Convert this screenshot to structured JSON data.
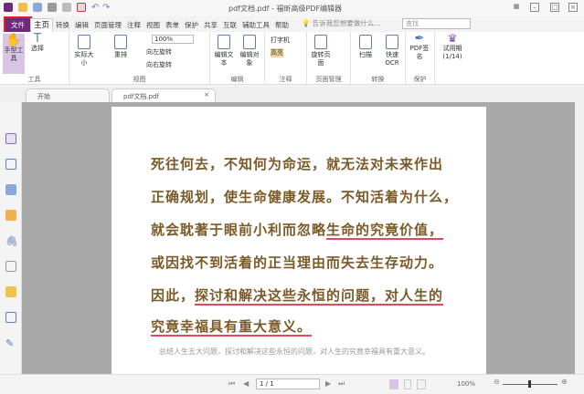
{
  "window": {
    "title": "pdf文档.pdf - 福昕高级PDF编辑器"
  },
  "menu_tabs": [
    "文件",
    "主页",
    "转换",
    "编辑",
    "页面管理",
    "注释",
    "视图",
    "表单",
    "保护",
    "共享",
    "互联",
    "辅助工具",
    "帮助"
  ],
  "search": {
    "placeholder": "告诉我您想要做什么...",
    "find_placeholder": "查找"
  },
  "ribbon": {
    "hand_tool": "手型工具",
    "select": "选择",
    "group_tools": "工具",
    "actual_size": "实际大小",
    "reflow": "重排",
    "zoom": "100%",
    "rotate_left": "向左旋转",
    "rotate_right": "向右旋转",
    "group_view": "视图",
    "edit_text": "编辑文本",
    "edit_object": "编辑对象",
    "group_edit": "编辑",
    "typewriter": "打字机",
    "highlight": "高亮",
    "group_comment": "注释",
    "rotate_page": "旋转页面",
    "group_page": "页面管理",
    "scan": "扫描",
    "quick_ocr": "快速OCR",
    "group_convert": "转换",
    "pdf_sign": "PDF签名",
    "group_protect": "保护",
    "trial": "试用期(1/14)"
  },
  "doc_tabs": [
    {
      "label": "开始"
    },
    {
      "label": "pdf文档.pdf"
    }
  ],
  "document": {
    "lines": [
      {
        "pre": "死往何去，不知何为命运，就无法对未来作出",
        "ul": ""
      },
      {
        "pre": "正确规划，使生命健康发展。不知活着为什么，",
        "ul": ""
      },
      {
        "pre": "就会耽著于眼前小利而忽略",
        "ul": "生命的究竟价值，"
      },
      {
        "pre": "或因找不到活着的正当理由而失去生存动力。",
        "ul": ""
      },
      {
        "pre": "因此，",
        "ul": "探讨和解决这些永恒的问题，对人生的"
      },
      {
        "pre": "",
        "ul": "究竟幸福具有重大意义。"
      }
    ],
    "note": "总结人生五大问题，探讨和解决这些永恒的问题，对人生的究竟幸福具有重大意义。"
  },
  "status": {
    "page": "1 / 1",
    "zoom": "100%"
  }
}
